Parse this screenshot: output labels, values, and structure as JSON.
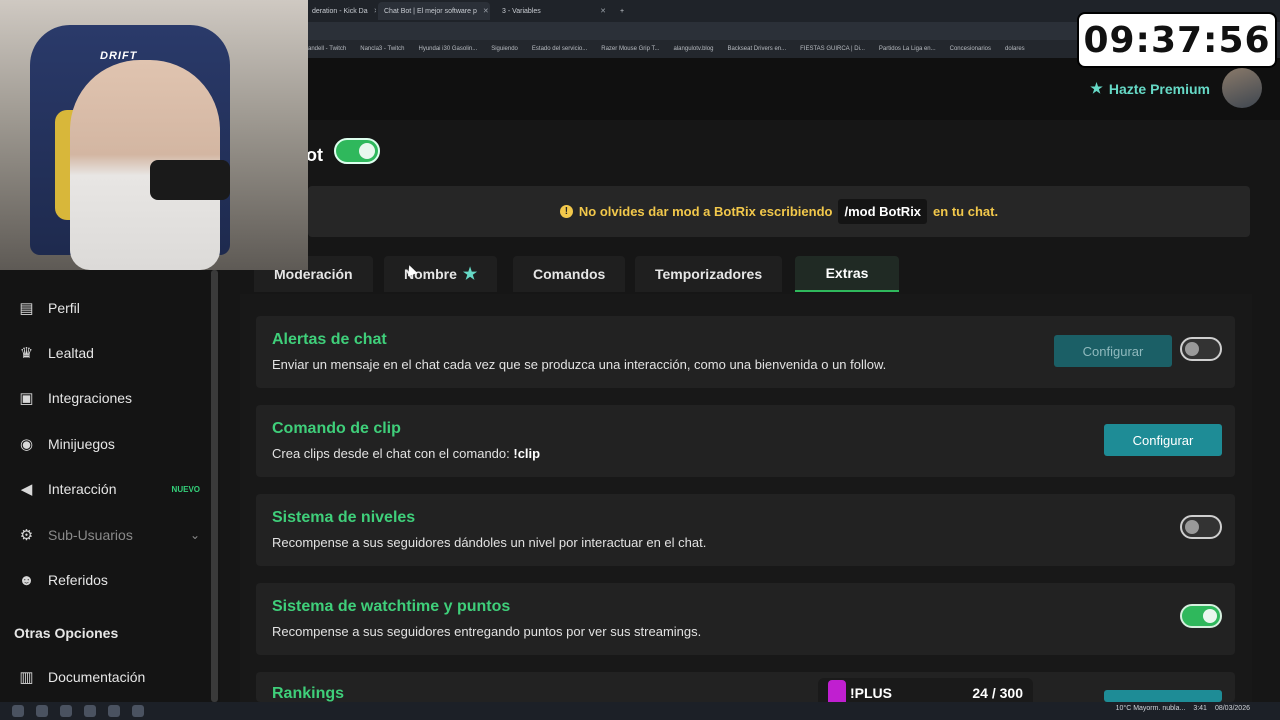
{
  "browser": {
    "tabs": [
      {
        "label": "deration - Kick Da"
      },
      {
        "label": "Chat Bot | El mejor software p"
      },
      {
        "label": "3 - Variables"
      }
    ],
    "new_tab": "+",
    "bookmarks": [
      "andell - Twitch",
      "Nancla3 - Twitch",
      "Hyundai i30 Gasolin...",
      "Siguiendo",
      "Estado del servicio...",
      "Razer Mouse Grip T...",
      "alangulotv.blog",
      "Backseat Drivers en...",
      "FIESTAS GUIRCA | Di...",
      "Partidos La Liga en...",
      "Concesionarios",
      "dolares"
    ]
  },
  "header": {
    "premium_label": "Hazte Premium",
    "title_fragment": "ot"
  },
  "notice": {
    "before": "No olvides dar mod a BotRix escribiendo",
    "code": "/mod BotRix",
    "after": "en tu chat."
  },
  "tabs": [
    {
      "label": "Moderación"
    },
    {
      "label": "Nombre"
    },
    {
      "label": "Comandos"
    },
    {
      "label": "Temporizadores"
    },
    {
      "label": "Extras"
    }
  ],
  "sidebar": {
    "items": [
      {
        "label": "Perfil",
        "icon": "id-card-icon"
      },
      {
        "label": "Lealtad",
        "icon": "trophy-icon"
      },
      {
        "label": "Integraciones",
        "icon": "puzzle-icon"
      },
      {
        "label": "Minijuegos",
        "icon": "gamepad-icon"
      },
      {
        "label": "Interacción",
        "icon": "bullhorn-icon",
        "badge": "NUEVO"
      },
      {
        "label": "Sub-Usuarios",
        "icon": "users-cog-icon"
      },
      {
        "label": "Referidos",
        "icon": "users-icon"
      }
    ],
    "section_title": "Otras Opciones",
    "doc_label": "Documentación"
  },
  "features": [
    {
      "title": "Alertas de chat",
      "desc": "Enviar un mensaje en el chat cada vez que se produzca una interacción, como una bienvenida o un follow.",
      "button": "Configurar",
      "enabled": false
    },
    {
      "title": "Comando de clip",
      "desc_prefix": "Crea clips desde el chat con el comando:",
      "desc_code": "!clip",
      "button": "Configurar"
    },
    {
      "title": "Sistema de niveles",
      "desc": "Recompense a sus seguidores dándoles un nivel por interactuar en el chat.",
      "enabled": false
    },
    {
      "title": "Sistema de watchtime y puntos",
      "desc": "Recompense a sus seguidores entregando puntos por ver sus streamings.",
      "enabled": true
    },
    {
      "title": "Rankings"
    }
  ],
  "overlay": {
    "clock": "09:37:56",
    "plus_label": "!PLUS",
    "plus_count": "24 / 300",
    "chair_brand": "DRIFT"
  },
  "taskbar": {
    "weather": "10°C Mayorm. nubla...",
    "time": "3:41",
    "date": "08/03/2026"
  },
  "colors": {
    "accent_green": "#3fcf7a",
    "config_button": "#1e8c96",
    "notice_yellow": "#f2c84b",
    "premium": "#66d9c6"
  }
}
